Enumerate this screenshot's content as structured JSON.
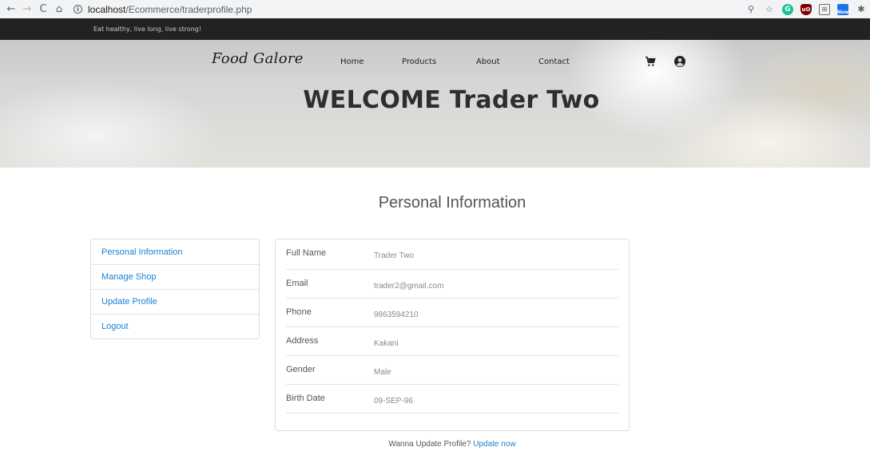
{
  "browser": {
    "back": "←",
    "forward": "→",
    "reload": "C",
    "home": "⌂",
    "info": "i",
    "url_host": "localhost",
    "url_path": "/Ecommerce/traderprofile.php",
    "zoom_icon": "⚲",
    "star_icon": "☆",
    "ext_grammarly": "G",
    "ext_ublock": "uO",
    "ext_box": "⊞",
    "ext_new": "New",
    "ext_puzzle": "✱"
  },
  "top_strip": {
    "tagline": "Eat healthy, live long, live strong!"
  },
  "header": {
    "logo": "Food Galore",
    "menu": {
      "home": "Home",
      "products": "Products",
      "about": "About",
      "contact": "Contact"
    },
    "icons": [
      "cart-icon",
      "user-icon"
    ]
  },
  "hero": {
    "title": "WELCOME Trader Two"
  },
  "main": {
    "section_title": "Personal Information",
    "side_menu": [
      {
        "label": "Personal Information"
      },
      {
        "label": "Manage Shop"
      },
      {
        "label": "Update Profile"
      },
      {
        "label": "Logout"
      }
    ],
    "info_rows": [
      {
        "label": "Full Name",
        "value": "Trader Two"
      },
      {
        "label": "Email",
        "value": "trader2@gmail.com"
      },
      {
        "label": "Phone",
        "value": "9863594210"
      },
      {
        "label": "Address",
        "value": "Kakani"
      },
      {
        "label": "Gender",
        "value": "Male"
      },
      {
        "label": "Birth Date",
        "value": "09-SEP-96"
      }
    ],
    "footer_text": "Wanna Update Profile?",
    "footer_link": "Update now"
  },
  "colors": {
    "link": "#1a7fd4",
    "top_strip": "#222222",
    "title_text": "#2e2e2e"
  }
}
